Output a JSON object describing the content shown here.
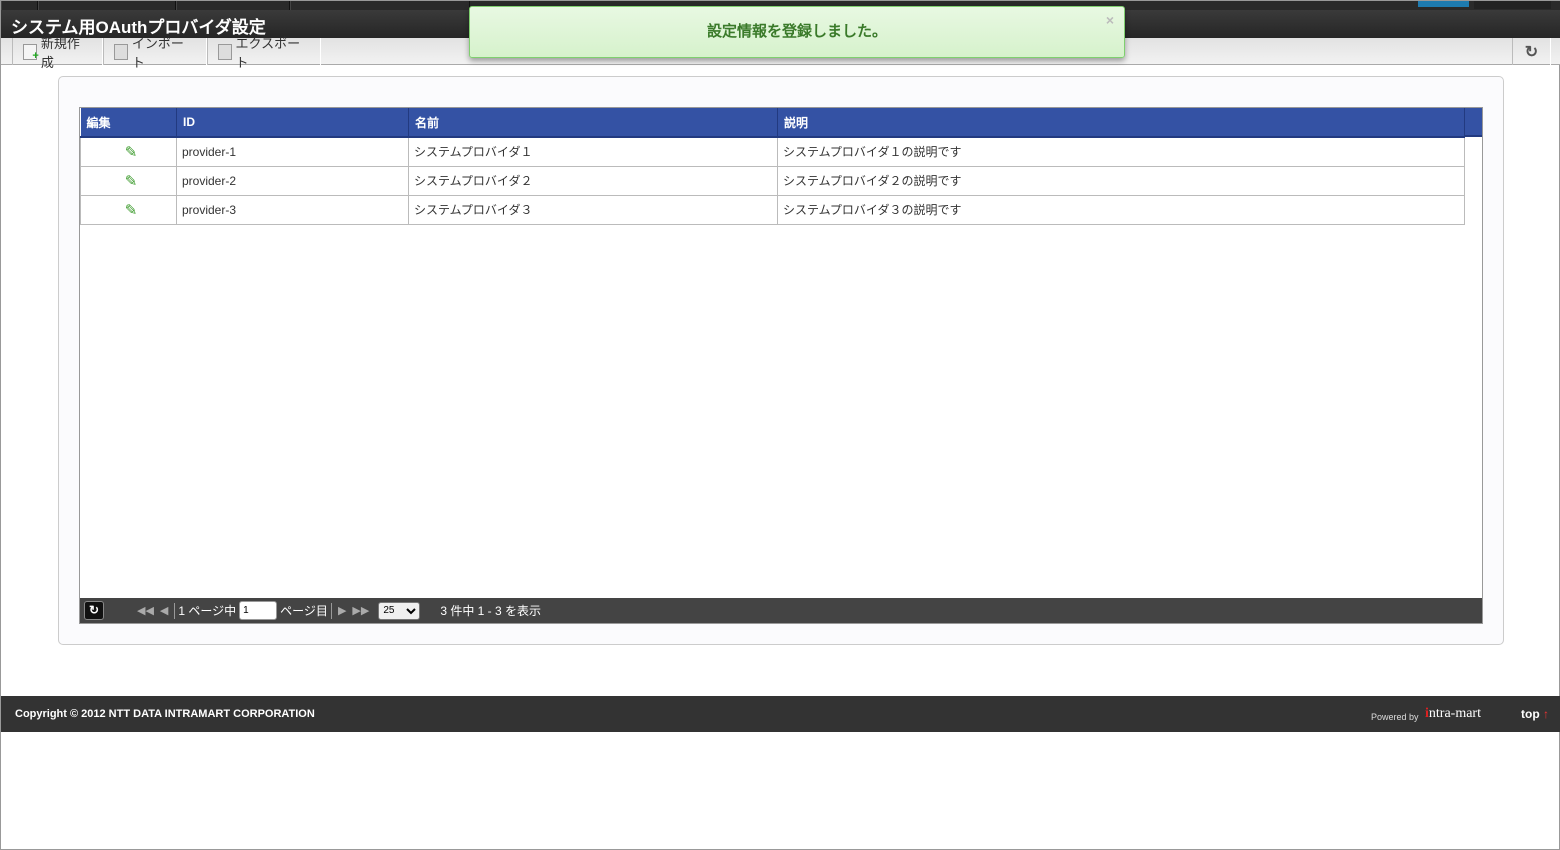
{
  "title": "システム用OAuthプロバイダ設定",
  "toolbar": {
    "new": "新規作成",
    "import": "インポート",
    "export": "エクスポート"
  },
  "toast": {
    "message": "設定情報を登録しました。",
    "close": "×"
  },
  "table": {
    "headers": [
      "編集",
      "ID",
      "名前",
      "説明"
    ],
    "rows": [
      {
        "id": "provider-1",
        "name": "システムプロバイダ１",
        "desc": "システムプロバイダ１の説明です"
      },
      {
        "id": "provider-2",
        "name": "システムプロバイダ２",
        "desc": "システムプロバイダ２の説明です"
      },
      {
        "id": "provider-3",
        "name": "システムプロバイダ３",
        "desc": "システムプロバイダ３の説明です"
      }
    ]
  },
  "pager": {
    "prefix": "1 ページ中",
    "page": "1",
    "suffix": "ページ目",
    "per_page": "25",
    "summary": "3 件中 1 - 3 を表示"
  },
  "footer": {
    "copyright": "Copyright © 2012 NTT DATA INTRAMART CORPORATION",
    "powered": "Powered by",
    "logo": "intra-mart",
    "top": "top"
  }
}
